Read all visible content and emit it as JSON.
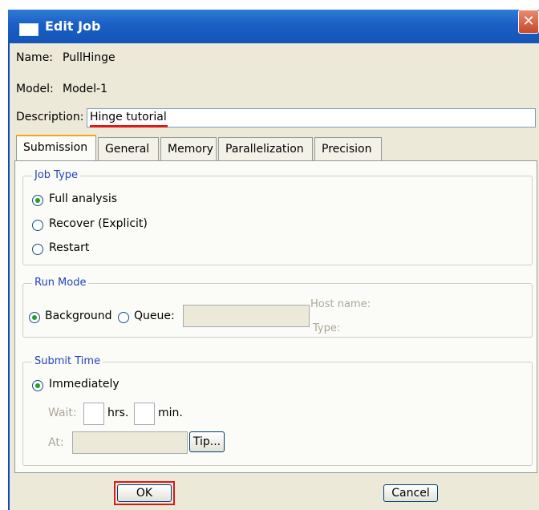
{
  "window": {
    "title": "Edit Job",
    "close_glyph": "✕"
  },
  "job": {
    "name_label": "Name:",
    "name_value": "PullHinge",
    "model_label": "Model:",
    "model_value": "Model-1",
    "description_label": "Description:",
    "description_value": "Hinge tutorial"
  },
  "tabs": [
    {
      "label": "Submission",
      "active": true
    },
    {
      "label": "General",
      "active": false
    },
    {
      "label": "Memory",
      "active": false
    },
    {
      "label": "Parallelization",
      "active": false
    },
    {
      "label": "Precision",
      "active": false
    }
  ],
  "job_type": {
    "legend": "Job Type",
    "options": [
      {
        "label": "Full analysis",
        "checked": true
      },
      {
        "label": "Recover (Explicit)",
        "checked": false
      },
      {
        "label": "Restart",
        "checked": false
      }
    ]
  },
  "run_mode": {
    "legend": "Run Mode",
    "background_label": "Background",
    "background_checked": true,
    "queue_label": "Queue:",
    "queue_checked": false,
    "queue_value": "",
    "host_name_label": "Host name:",
    "type_label": "Type:"
  },
  "submit_time": {
    "legend": "Submit Time",
    "immediately_label": "Immediately",
    "immediately_checked": true,
    "wait_label": "Wait:",
    "hrs_label": "hrs.",
    "min_label": "min.",
    "at_label": "At:",
    "tip_label": "Tip..."
  },
  "buttons": {
    "ok": "OK",
    "cancel": "Cancel"
  },
  "colors": {
    "title_bar": "#1a5fc4",
    "dialog_bg": "#ece9d8",
    "highlight": "#e01818",
    "legend_text": "#2344bb"
  }
}
